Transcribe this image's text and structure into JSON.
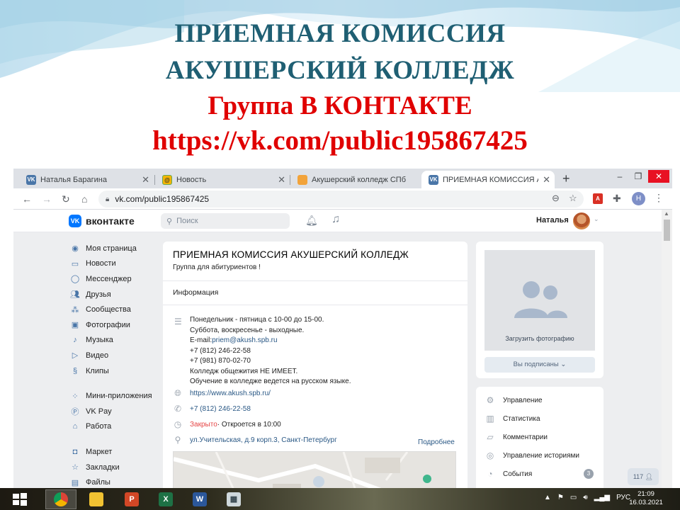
{
  "slide": {
    "line1": "ПРИЕМНАЯ КОМИССИЯ",
    "line2": "АКУШЕРСКИЙ КОЛЛЕДЖ",
    "line3": "Группа В КОНТАКТЕ",
    "line4": "https://vk.com/public195867425"
  },
  "browser": {
    "tabs": [
      {
        "title": "Наталья Барагина",
        "icon": "vk-favicon",
        "active": false
      },
      {
        "title": "Новость",
        "icon": "mail-favicon",
        "active": false
      },
      {
        "title": "Акушерский колледж СПб",
        "icon": "college-favicon",
        "active": false
      },
      {
        "title": "ПРИЕМНАЯ КОМИССИЯ АК",
        "icon": "vk-favicon",
        "active": true
      }
    ],
    "new_tab": "+",
    "window_controls": {
      "minimize": "–",
      "maximize": "❐",
      "close": "✕"
    },
    "url": "vk.com/public195867425",
    "profile_initial": "Н",
    "pdf_ext": "A"
  },
  "vk": {
    "logo_text": "вконтакте",
    "logo_mark": "VK",
    "search_placeholder": "Поиск",
    "user_name": "Наталья",
    "menu": [
      {
        "label": "Моя страница",
        "icon": "user-circle-icon"
      },
      {
        "label": "Новости",
        "icon": "news-icon"
      },
      {
        "label": "Мессенджер",
        "icon": "chat-icon"
      },
      {
        "label": "Друзья",
        "icon": "friends-icon"
      },
      {
        "label": "Сообщества",
        "icon": "communities-icon"
      },
      {
        "label": "Фотографии",
        "icon": "photo-icon"
      },
      {
        "label": "Музыка",
        "icon": "music-icon"
      },
      {
        "label": "Видео",
        "icon": "video-icon"
      },
      {
        "label": "Клипы",
        "icon": "clips-icon"
      },
      {
        "label": "Мини-приложения",
        "icon": "apps-icon"
      },
      {
        "label": "VK Pay",
        "icon": "pay-icon"
      },
      {
        "label": "Работа",
        "icon": "briefcase-icon"
      },
      {
        "label": "Маркет",
        "icon": "bag-icon"
      },
      {
        "label": "Закладки",
        "icon": "star-icon"
      },
      {
        "label": "Файлы",
        "icon": "file-icon"
      }
    ],
    "group": {
      "name": "ПРИЕМНАЯ КОМИССИЯ АКУШЕРСКИЙ КОЛЛЕДЖ",
      "status": "Группа для абитуриентов !",
      "info_title": "Информация",
      "description": [
        "Понедельник - пятница с 10-00 до 15-00.",
        "Суббота, воскресенье - выходные.",
        "E-mail:priem@akush.spb.ru",
        "+7 (812) 246-22-58",
        "+7 (981) 870-02-70",
        "Колледж общежития НЕ ИМЕЕТ.",
        "Обучение в колледже ведется на русском языке."
      ],
      "email_prefix": "E-mail:",
      "email": "priem@akush.spb.ru",
      "website": "https://www.akush.spb.ru/",
      "phone": "+7 (812) 246-22-58",
      "hours_status": "Закрыто",
      "hours_next": " · Откроется в 10:00",
      "address": "ул.Учительская, д.9 корп.3, Санкт-Петербург",
      "more": "Подробнее"
    },
    "photo": {
      "upload_label": "Загрузить фотографию",
      "subscribed": "Вы подписаны ⌄"
    },
    "manage": [
      {
        "label": "Управление",
        "icon": "gear-icon"
      },
      {
        "label": "Статистика",
        "icon": "stats-icon"
      },
      {
        "label": "Комментарии",
        "icon": "comment-icon"
      },
      {
        "label": "Управление историями",
        "icon": "stories-icon"
      },
      {
        "label": "События",
        "icon": "event-icon",
        "badge": "3"
      }
    ],
    "online_counter": "117"
  },
  "taskbar": {
    "apps": [
      {
        "name": "chrome",
        "glyph": "●"
      },
      {
        "name": "explorer",
        "glyph": "▬"
      },
      {
        "name": "powerpoint",
        "glyph": "P"
      },
      {
        "name": "excel",
        "glyph": "X"
      },
      {
        "name": "word",
        "glyph": "W"
      },
      {
        "name": "calculator",
        "glyph": "▦"
      }
    ],
    "lang": "РУС",
    "time": "21:09",
    "date": "16.03.2021"
  },
  "colors": {
    "vk_blue": "#0077ff",
    "slide_teal": "#1f5f73",
    "slide_red": "#e00000",
    "closed_red": "#e64646",
    "link_blue": "#2a5885"
  }
}
